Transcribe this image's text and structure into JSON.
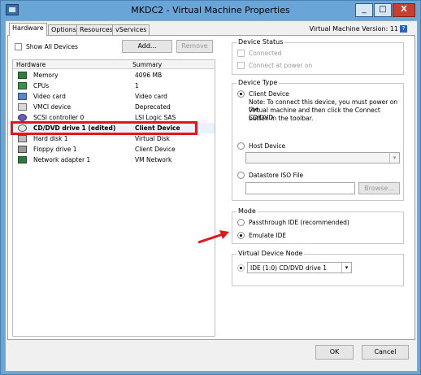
{
  "window": {
    "title": "MKDC2 - Virtual Machine Properties",
    "min_glyph": "_",
    "max_glyph": "□",
    "close_glyph": "X"
  },
  "tabs": [
    {
      "label": "Hardware",
      "active": true
    },
    {
      "label": "Options",
      "active": false
    },
    {
      "label": "Resources",
      "active": false
    },
    {
      "label": "vServices",
      "active": false
    }
  ],
  "vm_version": "Virtual Machine Version: 11",
  "help_glyph": "?",
  "show_all_devices": {
    "label": "Show All Devices",
    "checked": false
  },
  "buttons": {
    "add": "Add...",
    "remove": "Remove",
    "ok": "OK",
    "cancel": "Cancel",
    "browse": "Browse..."
  },
  "hardware_table": {
    "columns": [
      "Hardware",
      "Summary"
    ],
    "rows": [
      {
        "name": "Memory",
        "summary": "4096 MB",
        "icon": "memory-icon"
      },
      {
        "name": "CPUs",
        "summary": "1",
        "icon": "cpu-icon"
      },
      {
        "name": "Video card",
        "summary": "Video card",
        "icon": "video-card-icon"
      },
      {
        "name": "VMCI device",
        "summary": "Deprecated",
        "icon": "vmci-device-icon"
      },
      {
        "name": "SCSI controller 0",
        "summary": "LSI Logic SAS",
        "icon": "scsi-controller-icon"
      },
      {
        "name": "CD/DVD drive 1 (edited)",
        "summary": "Client Device",
        "icon": "cd-dvd-icon",
        "selected": true
      },
      {
        "name": "Hard disk 1",
        "summary": "Virtual Disk",
        "icon": "hard-disk-icon"
      },
      {
        "name": "Floppy drive 1",
        "summary": "Client Device",
        "icon": "floppy-icon"
      },
      {
        "name": "Network adapter 1",
        "summary": "VM Network",
        "icon": "network-adapter-icon"
      }
    ]
  },
  "device_status": {
    "title": "Device Status",
    "connected": "Connected",
    "connect_at_power_on": "Connect at power on"
  },
  "device_type": {
    "title": "Device Type",
    "client_device": "Client Device",
    "note_lines": [
      "Note: To connect this device, you must power on the",
      "virtual machine and then click the Connect CD/DVD",
      "button in the toolbar."
    ],
    "host_device": "Host Device",
    "datastore_iso": "Datastore ISO File"
  },
  "mode": {
    "title": "Mode",
    "passthrough": "Passthrough IDE (recommended)",
    "emulate": "Emulate IDE"
  },
  "virtual_device_node": {
    "title": "Virtual Device Node",
    "value": "IDE (1:0) CD/DVD drive 1"
  },
  "colors": {
    "highlight": "#e01818",
    "titlebar": "#6aa5d8"
  }
}
